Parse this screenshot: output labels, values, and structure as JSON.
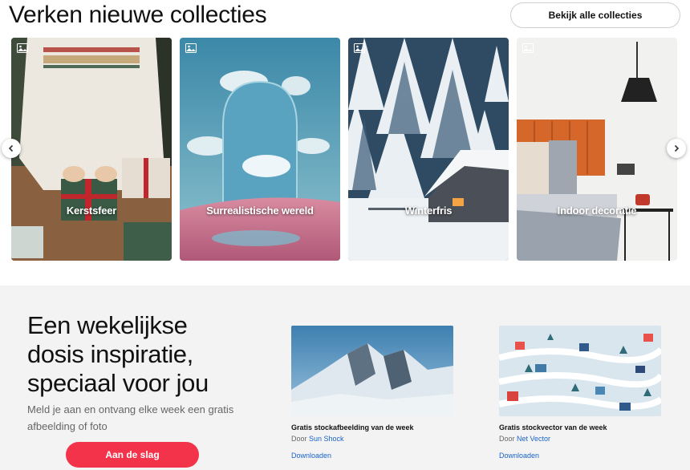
{
  "header": {
    "title": "Verken nieuwe collecties",
    "view_all": "Bekijk alle collecties"
  },
  "collections": [
    {
      "label": "Kerstsfeer",
      "icon": "image-icon"
    },
    {
      "label": "Surrealistische wereld",
      "icon": "image-icon"
    },
    {
      "label": "Winterfris",
      "icon": "image-icon"
    },
    {
      "label": "Indoor decoratie",
      "icon": "image-icon"
    }
  ],
  "carousel": {
    "prev_icon": "chevron-left-icon",
    "next_icon": "chevron-right-icon"
  },
  "newsletter": {
    "headline_1": "Een wekelijkse",
    "headline_2": "dosis inspiratie,",
    "headline_3": "speciaal voor jou",
    "subtitle": "Meld je aan en ontvang elke week een gratis afbeelding of foto",
    "cta": "Aan de slag"
  },
  "weekly": [
    {
      "title": "Gratis stockafbeelding van de week",
      "by_prefix": "Door",
      "author": "Sun Shock",
      "download": "Downloaden"
    },
    {
      "title": "Gratis stockvector van de week",
      "by_prefix": "Door",
      "author": "Net Vector",
      "download": "Downloaden"
    }
  ],
  "colors": {
    "accent": "#f2334a",
    "link": "#1a63c7",
    "section_bg": "#f3f3f4"
  }
}
